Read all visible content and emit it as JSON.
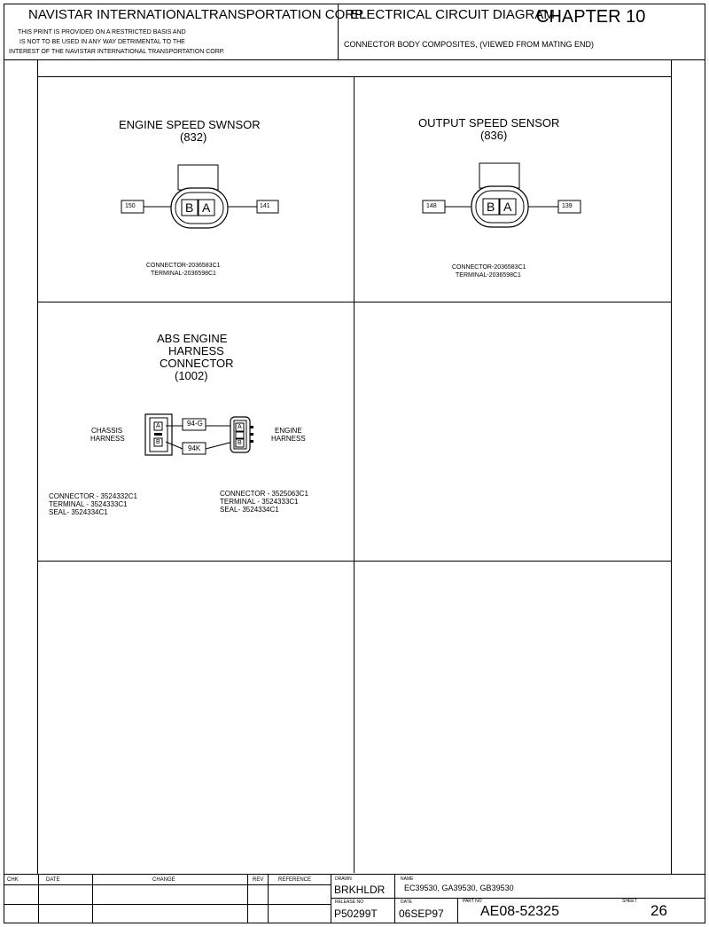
{
  "header": {
    "company": "NAVISTAR INTERNATIONALTRANSPORTATION CORP.",
    "disclaimer_line1": "THIS PRINT IS PROVIDED ON A RESTRICTED BASIS AND",
    "disclaimer_line2": "IS NOT TO BE USED IN ANY WAY DETRIMENTAL TO THE",
    "disclaimer_line3": "INTEREST OF THE NAVISTAR INTERNATIONAL TRANSPORTATION CORP.",
    "diagram_title": "ELECTRICAL CIRCUIT DIAGRAM",
    "chapter": "CHAPTER 10",
    "subtitle": "CONNECTOR BODY COMPOSITES, (VIEWED FROM MATING END)"
  },
  "panels": {
    "engine_speed": {
      "title": "ENGINE SPEED SWNSOR",
      "number": "(832)",
      "wire_left": "150",
      "wire_right": "141",
      "pin_b": "B",
      "pin_a": "A",
      "connector": "CONNECTOR-2036583C1",
      "terminal": "TERMINAL-2036598C1"
    },
    "output_speed": {
      "title": "OUTPUT SPEED SENSOR",
      "number": "(836)",
      "wire_left": "148",
      "wire_right": "139",
      "pin_b": "B",
      "pin_a": "A",
      "connector": "CONNECTOR-2036583C1",
      "terminal": "TERMINAL-2036598C1"
    },
    "abs_engine": {
      "title_line1": "ABS ENGINE",
      "title_line2": "HARNESS",
      "title_line3": "CONNECTOR",
      "number": "(1002)",
      "left_label_line1": "CHASSIS",
      "left_label_line2": "HARNESS",
      "right_label_line1": "ENGINE",
      "right_label_line2": "HARNESS",
      "wire_top": "94-G",
      "wire_bottom": "94K",
      "pin_a": "A",
      "pin_b": "B",
      "left_connector": "CONNECTOR - 3524332C1",
      "left_terminal": "TERMINAL - 3524333C1",
      "left_seal": "SEAL- 3524334C1",
      "right_connector": "CONNECTOR - 3525063C1",
      "right_terminal": "TERMINAL - 3524333C1",
      "right_seal": "SEAL- 3524334C1"
    }
  },
  "title_block": {
    "col_chk": "CHK",
    "col_date": "DATE",
    "col_change": "CHANGE",
    "col_rev": "REV",
    "col_reference": "REFERENCE",
    "drawn_label": "DRAWN",
    "drawn_value": "BRKHLDR",
    "name_label": "NAME",
    "name_value": "EC39530, GA39530, GB39530",
    "release_label": "RELEASE NO",
    "release_value": "P50299T",
    "date_label": "DATE",
    "date_value": "06SEP97",
    "part_label": "PART NO",
    "part_value": "AE08-52325",
    "sheet_label": "SHEET",
    "sheet_value": "26"
  }
}
